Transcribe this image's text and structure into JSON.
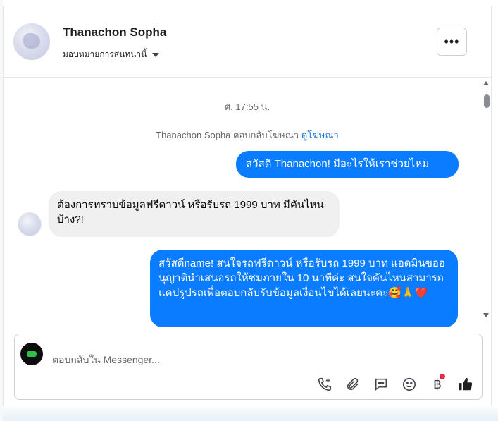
{
  "header": {
    "contact_name": "Thanachon Sopha",
    "assign_label": "มอบหมายการสนทนานี้",
    "more_label": "•••"
  },
  "thread": {
    "timestamp": "ศ. 17:55 น.",
    "ad_reply_text": "Thanachon Sopha ตอบกลับโฆษณา",
    "ad_link": "ดูโฆษณา",
    "messages": [
      {
        "direction": "out",
        "text": "สวัสดี Thanachon! มีอะไรให้เราช่วยไหม"
      },
      {
        "direction": "in",
        "text": "ต้องการทราบข้อมูลฟรีดาวน์ หรือรับรถ 1999 บาท มีคันไหนบ้าง?!"
      },
      {
        "direction": "out",
        "text": "สวัสดีname! สนใจรถฟรีดาวน์ หรือรับรถ 1999 บาท แอดมินขออนุญาตินำเสนอรถให้ชมภายใน 10 นาทีค่ะ สนใจคันไหนสามารถแคปรูปรถเพื่อตอบกลับรับข้อมูลเงื่อนไขได้เลยนะคะ🥰🙏❤️"
      }
    ]
  },
  "composer": {
    "placeholder": "ตอบกลับใน Messenger...",
    "baht_symbol": "฿"
  },
  "colors": {
    "outgoing_bubble": "#0a7cff",
    "incoming_bubble": "#f0f0f0",
    "link": "#1b74e4",
    "notification_dot": "#f02849"
  },
  "icons": [
    "phone-add-icon",
    "paperclip-icon",
    "chat-bubble-icon",
    "smiley-icon",
    "baht-icon",
    "thumbs-up-icon"
  ]
}
